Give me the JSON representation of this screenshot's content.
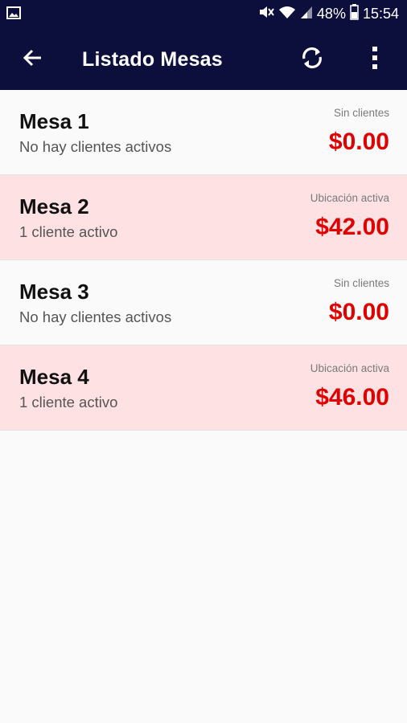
{
  "status_bar": {
    "battery": "48%",
    "time": "15:54",
    "icons": [
      "gallery-icon",
      "mute-icon",
      "wifi-icon",
      "signal-icon",
      "battery-icon"
    ]
  },
  "app_bar": {
    "title": "Listado Mesas",
    "icons": [
      "back-arrow-icon",
      "refresh-icon",
      "more-vert-icon"
    ]
  },
  "tables": [
    {
      "name": "Mesa 1",
      "subtitle": "No hay clientes activos",
      "status": "Sin clientes",
      "amount": "$0.00",
      "state": "free"
    },
    {
      "name": "Mesa 2",
      "subtitle": "1 cliente activo",
      "status": "Ubicación activa",
      "amount": "$42.00",
      "state": "busy"
    },
    {
      "name": "Mesa 3",
      "subtitle": "No hay clientes activos",
      "status": "Sin clientes",
      "amount": "$0.00",
      "state": "free"
    },
    {
      "name": "Mesa 4",
      "subtitle": "1 cliente activo",
      "status": "Ubicación activa",
      "amount": "$46.00",
      "state": "busy"
    }
  ],
  "colors": {
    "app_bar": "#0c0f3c",
    "busy_row": "#fde1e3",
    "amount": "#e00000"
  }
}
